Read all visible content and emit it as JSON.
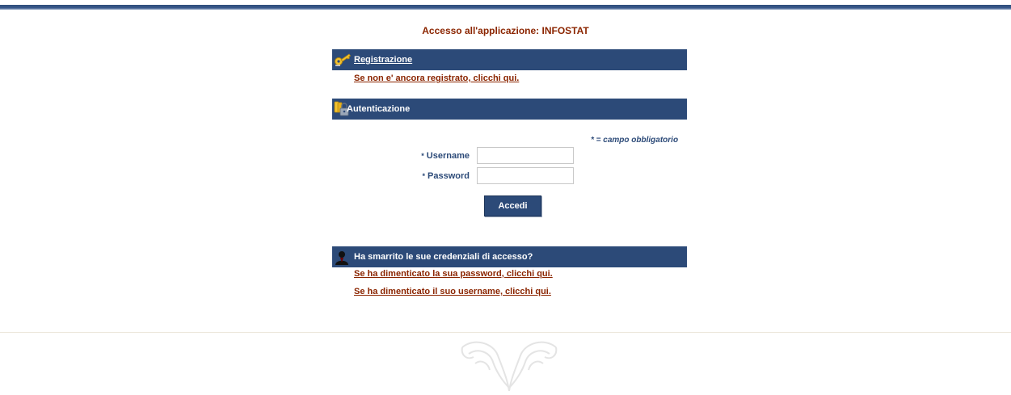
{
  "page": {
    "title": "Accesso all'applicazione: INFOSTAT"
  },
  "registration": {
    "header": "Registrazione",
    "icon": "key-icon",
    "link": "Se non e' ancora registrato, clicchi qui."
  },
  "authentication": {
    "header": "Autenticazione",
    "icon": "keys-lock-icon",
    "required_note": "* = campo obbligatorio",
    "username_label": "Username",
    "password_label": "Password",
    "required_marker": "*",
    "username_value": "",
    "password_value": "",
    "submit_label": "Accedi"
  },
  "recovery": {
    "header": "Ha smarrito le sue credenziali di accesso?",
    "icon": "user-silhouette-icon",
    "forgot_password_link": "Se ha dimenticato la sua password, clicchi qui.",
    "forgot_username_link": "Se ha dimenticato il suo username, clicchi qui."
  },
  "colors": {
    "header_bar": "#2c4a78",
    "link_text": "#8b2500",
    "label_text": "#2c4a78"
  }
}
